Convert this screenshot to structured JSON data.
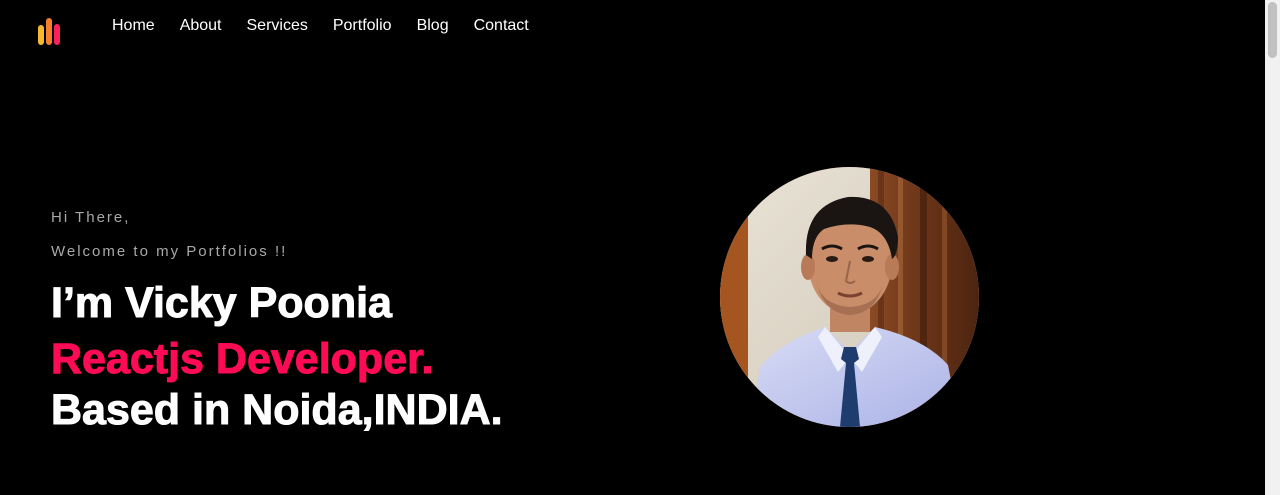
{
  "header": {
    "logo": {
      "icon": "bar-chart-logo-icon",
      "colors": [
        "#f5b82e",
        "#f77f2a",
        "#ff1f5a"
      ]
    },
    "nav": [
      {
        "label": "Home"
      },
      {
        "label": "About"
      },
      {
        "label": "Services"
      },
      {
        "label": "Portfolio"
      },
      {
        "label": "Blog"
      },
      {
        "label": "Contact"
      }
    ]
  },
  "hero": {
    "greeting": "Hi There,",
    "welcome": "Welcome to my Portfolios !!",
    "name_line": "I’m Vicky Poonia",
    "role_line": "Reactjs Developer.",
    "location_line": "Based in Noida,INDIA.",
    "accent_color": "#ff0a54",
    "portrait": "profile-photo"
  },
  "colors": {
    "background": "#000000",
    "text": "#ffffff",
    "muted": "#a8a8a8"
  }
}
